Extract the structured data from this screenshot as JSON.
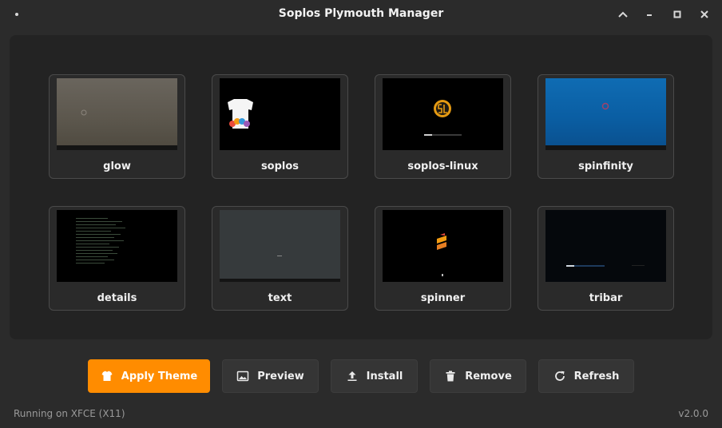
{
  "window": {
    "title": "Soplos Plymouth Manager"
  },
  "themes": [
    {
      "name": "glow"
    },
    {
      "name": "soplos"
    },
    {
      "name": "soplos-linux"
    },
    {
      "name": "spinfinity"
    },
    {
      "name": "details"
    },
    {
      "name": "text"
    },
    {
      "name": "spinner"
    },
    {
      "name": "tribar"
    }
  ],
  "actions": {
    "apply": "Apply Theme",
    "preview": "Preview",
    "install": "Install",
    "remove": "Remove",
    "refresh": "Refresh"
  },
  "status": {
    "left": "Running on XFCE (X11)",
    "version": "v2.0.0"
  },
  "colors": {
    "accent": "#ff8c00",
    "background": "#2b2b2b",
    "panel": "#232323"
  }
}
